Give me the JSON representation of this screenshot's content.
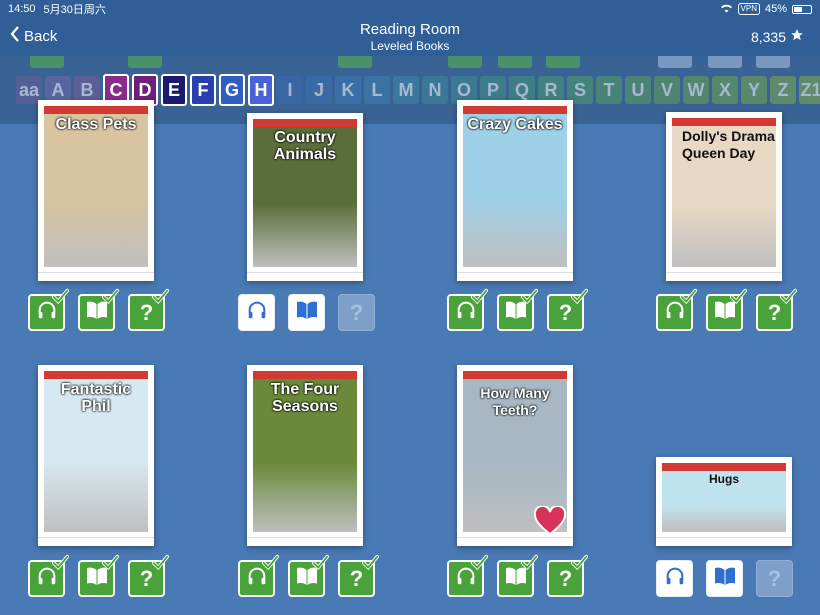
{
  "status": {
    "time": "14:50",
    "date": "5月30日周六",
    "vpn": "VPN",
    "battery": "45%"
  },
  "header": {
    "back_label": "Back",
    "title": "Reading Room",
    "subtitle": "Leveled Books",
    "stars": "8,335"
  },
  "levels": {
    "items": [
      "aa",
      "A",
      "B",
      "C",
      "D",
      "E",
      "F",
      "G",
      "H",
      "I",
      "J",
      "K",
      "L",
      "M",
      "N",
      "O",
      "P",
      "Q",
      "R",
      "S",
      "T",
      "U",
      "V",
      "W",
      "X",
      "Y",
      "Z",
      "Z1"
    ],
    "colors": [
      "#6a5a9a",
      "#6f6aa8",
      "#7c5a9a",
      "#8a2a8a",
      "#6c1f7c",
      "#1a1a6e",
      "#2a3fb0",
      "#2f5fbf",
      "#4a62d8",
      "#3a6bb0",
      "#3a70b5",
      "#3a78b8",
      "#3a80b0",
      "#3a8aa8",
      "#3a8a9c",
      "#3c8f8e",
      "#3f9284",
      "#43967c",
      "#489a72",
      "#4c9c6a",
      "#549e62",
      "#5aa05a",
      "#60a254",
      "#66a44e",
      "#6ca64c",
      "#72a84a",
      "#78aa48",
      "#7eac46"
    ],
    "selected": [
      "C",
      "D",
      "E",
      "F",
      "G",
      "H"
    ]
  },
  "books": [
    {
      "title": "Class Pets",
      "cover": "#d8c4a0",
      "title_style": "light",
      "actions": [
        "done",
        "done",
        "done"
      ]
    },
    {
      "title": "Country Animals",
      "cover": "#5b6e3a",
      "title_style": "light",
      "actions": [
        "open",
        "open",
        "disabled"
      ]
    },
    {
      "title": "Crazy Cakes",
      "cover": "#9ed0e8",
      "title_style": "light",
      "actions": [
        "done",
        "done",
        "done"
      ]
    },
    {
      "title": "Dolly's Drama Queen Day",
      "cover": "#e9d9c4",
      "title_style": "dark",
      "actions": [
        "done",
        "done",
        "done"
      ]
    },
    {
      "title": "Fantastic Phil",
      "cover": "#d6e8f0",
      "title_style": "light",
      "actions": [
        "done",
        "done",
        "done"
      ]
    },
    {
      "title": "The Four Seasons",
      "cover": "#6a8a3a",
      "title_style": "light",
      "actions": [
        "done",
        "done",
        "done"
      ]
    },
    {
      "title": "How Many Teeth?",
      "cover": "#a7b8c4",
      "title_style": "light",
      "actions": [
        "done",
        "done",
        "done"
      ]
    },
    {
      "title": "Hugs",
      "cover": "#bfe3ee",
      "title_style": "dark",
      "actions": [
        "open",
        "open",
        "disabled"
      ]
    }
  ],
  "icons": {
    "back": "chevron-left-icon",
    "star": "star-icon",
    "listen": "headphones-icon",
    "read": "open-book-icon",
    "quiz": "question-mark-icon",
    "complete": "checkmark-icon",
    "favorite": "heart-icon"
  },
  "colors": {
    "background": "#4a7ab5",
    "navbar": "#2f5f96",
    "done": "#4aa33a",
    "open": "#ffffff",
    "disabled": "#7f9fcb",
    "open_icon": "#2f6fd0"
  }
}
